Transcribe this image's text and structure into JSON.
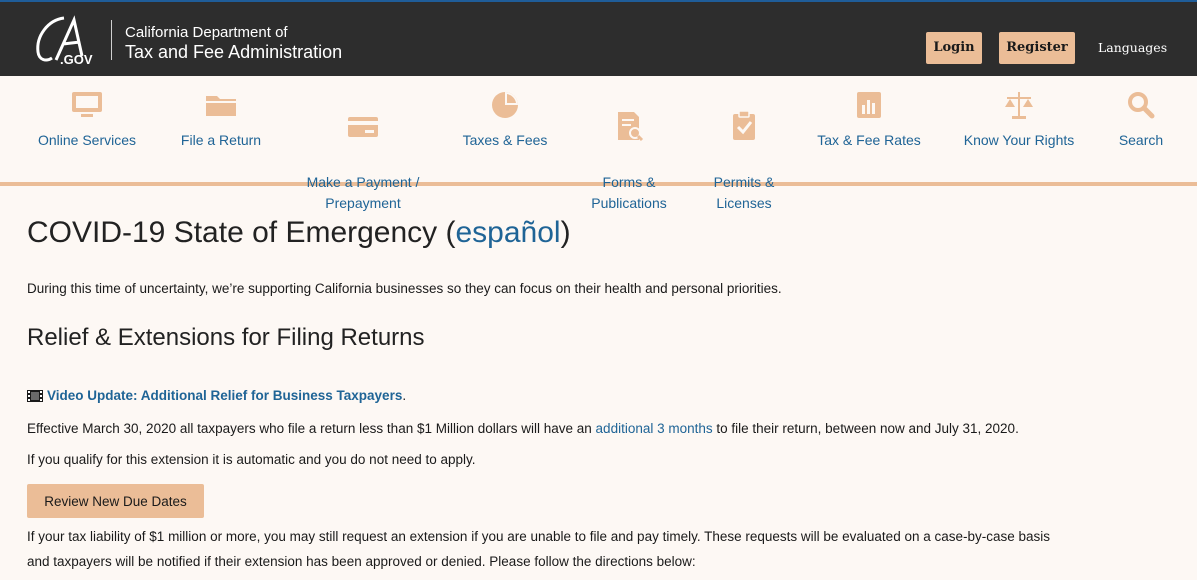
{
  "header": {
    "logo_text": "CA.GOV",
    "dept_line1": "California Department of",
    "dept_line2": "Tax and Fee Administration",
    "login_label": "Login",
    "register_label": "Register",
    "languages_label": "Languages"
  },
  "nav": {
    "items": [
      {
        "label": "Online Services",
        "icon": "monitor-icon"
      },
      {
        "label": "File a Return",
        "icon": "folder-icon"
      },
      {
        "label": "Make a Payment /\nPrepayment",
        "icon": "credit-card-icon"
      },
      {
        "label": "Taxes & Fees",
        "icon": "pie-chart-icon"
      },
      {
        "label": "Forms &\nPublications",
        "icon": "document-search-icon"
      },
      {
        "label": "Permits &\nLicenses",
        "icon": "clipboard-check-icon"
      },
      {
        "label": "Tax & Fee Rates",
        "icon": "bar-chart-icon"
      },
      {
        "label": "Know Your Rights",
        "icon": "scales-icon"
      },
      {
        "label": "Search",
        "icon": "search-icon"
      }
    ]
  },
  "main": {
    "title": "COVID-19 State of Emergency (",
    "title_link": "español",
    "title_end": ")",
    "intro": "During this time of uncertainty, we’re supporting California businesses so they can focus on their health and personal priorities.",
    "subtitle": "Relief & Extensions for Filing Returns",
    "video_link": "Video Update: Additional Relief for Business Taxpayers",
    "video_period": ".",
    "effective_pre": "Effective March 30, 2020 all taxpayers who file a return less than $1 Million dollars will have an ",
    "effective_link": "additional 3 months",
    "effective_post": " to file their return, between now and July 31, 2020.",
    "qualify": "If you qualify for this extension it is automatic and you do not need to apply.",
    "review_button": "Review New Due Dates",
    "liability_line1": "If your tax liability of $1 million or more, you may still request an extension if you are unable to file and pay timely. These requests will be evaluated on a case-by-case basis",
    "liability_line2": "and taxpayers will be notified if their extension has been approved or denied. Please follow the directions below:"
  },
  "colors": {
    "header_bg": "#2d2d2d",
    "accent": "#ebbd97",
    "link": "#1f6496",
    "page_bg": "#fdf8f4"
  }
}
